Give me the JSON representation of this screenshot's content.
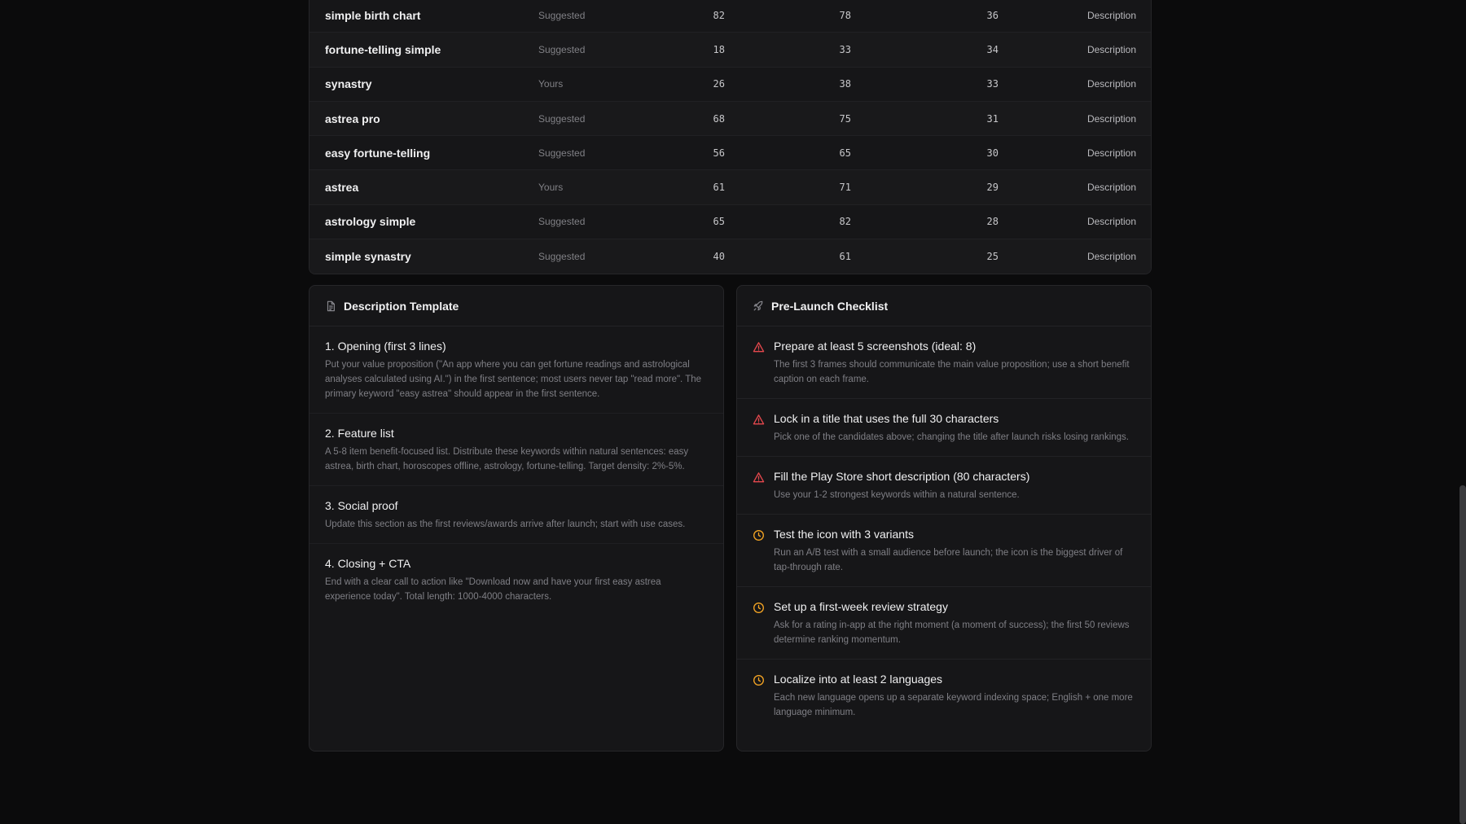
{
  "keywords": [
    {
      "name": "simple birth chart",
      "source": "Suggested",
      "n1": "82",
      "n2": "78",
      "n3": "36",
      "action": "Description"
    },
    {
      "name": "fortune-telling simple",
      "source": "Suggested",
      "n1": "18",
      "n2": "33",
      "n3": "34",
      "action": "Description"
    },
    {
      "name": "synastry",
      "source": "Yours",
      "n1": "26",
      "n2": "38",
      "n3": "33",
      "action": "Description"
    },
    {
      "name": "astrea pro",
      "source": "Suggested",
      "n1": "68",
      "n2": "75",
      "n3": "31",
      "action": "Description"
    },
    {
      "name": "easy fortune-telling",
      "source": "Suggested",
      "n1": "56",
      "n2": "65",
      "n3": "30",
      "action": "Description"
    },
    {
      "name": "astrea",
      "source": "Yours",
      "n1": "61",
      "n2": "71",
      "n3": "29",
      "action": "Description"
    },
    {
      "name": "astrology simple",
      "source": "Suggested",
      "n1": "65",
      "n2": "82",
      "n3": "28",
      "action": "Description"
    },
    {
      "name": "simple synastry",
      "source": "Suggested",
      "n1": "40",
      "n2": "61",
      "n3": "25",
      "action": "Description"
    }
  ],
  "description_template": {
    "title": "Description Template",
    "icon": "document-icon",
    "sections": [
      {
        "title": "1. Opening (first 3 lines)",
        "body": "Put your value proposition (\"An app where you can get fortune readings and astrological analyses calculated using AI.\") in the first sentence; most users never tap \"read more\". The primary keyword \"easy astrea\" should appear in the first sentence."
      },
      {
        "title": "2. Feature list",
        "body": "A 5-8 item benefit-focused list. Distribute these keywords within natural sentences: easy astrea, birth chart, horoscopes offline, astrology, fortune-telling. Target density: 2%-5%."
      },
      {
        "title": "3. Social proof",
        "body": "Update this section as the first reviews/awards arrive after launch; start with use cases."
      },
      {
        "title": "4. Closing + CTA",
        "body": "End with a clear call to action like \"Download now and have your first easy astrea experience today\". Total length: 1000-4000 characters."
      }
    ]
  },
  "checklist": {
    "title": "Pre-Launch Checklist",
    "icon": "rocket-icon",
    "colors": {
      "warning": "#e5484d",
      "pending": "#f5a524"
    },
    "items": [
      {
        "status": "warning",
        "icon": "warning-triangle-icon",
        "title": "Prepare at least 5 screenshots (ideal: 8)",
        "body": "The first 3 frames should communicate the main value proposition; use a short benefit caption on each frame."
      },
      {
        "status": "warning",
        "icon": "warning-triangle-icon",
        "title": "Lock in a title that uses the full 30 characters",
        "body": "Pick one of the candidates above; changing the title after launch risks losing rankings."
      },
      {
        "status": "warning",
        "icon": "warning-triangle-icon",
        "title": "Fill the Play Store short description (80 characters)",
        "body": "Use your 1-2 strongest keywords within a natural sentence."
      },
      {
        "status": "pending",
        "icon": "pending-circle-icon",
        "title": "Test the icon with 3 variants",
        "body": "Run an A/B test with a small audience before launch; the icon is the biggest driver of tap-through rate."
      },
      {
        "status": "pending",
        "icon": "pending-circle-icon",
        "title": "Set up a first-week review strategy",
        "body": "Ask for a rating in-app at the right moment (a moment of success); the first 50 reviews determine ranking momentum."
      },
      {
        "status": "pending",
        "icon": "pending-circle-icon",
        "title": "Localize into at least 2 languages",
        "body": "Each new language opens up a separate keyword indexing space; English + one more language minimum."
      }
    ]
  }
}
